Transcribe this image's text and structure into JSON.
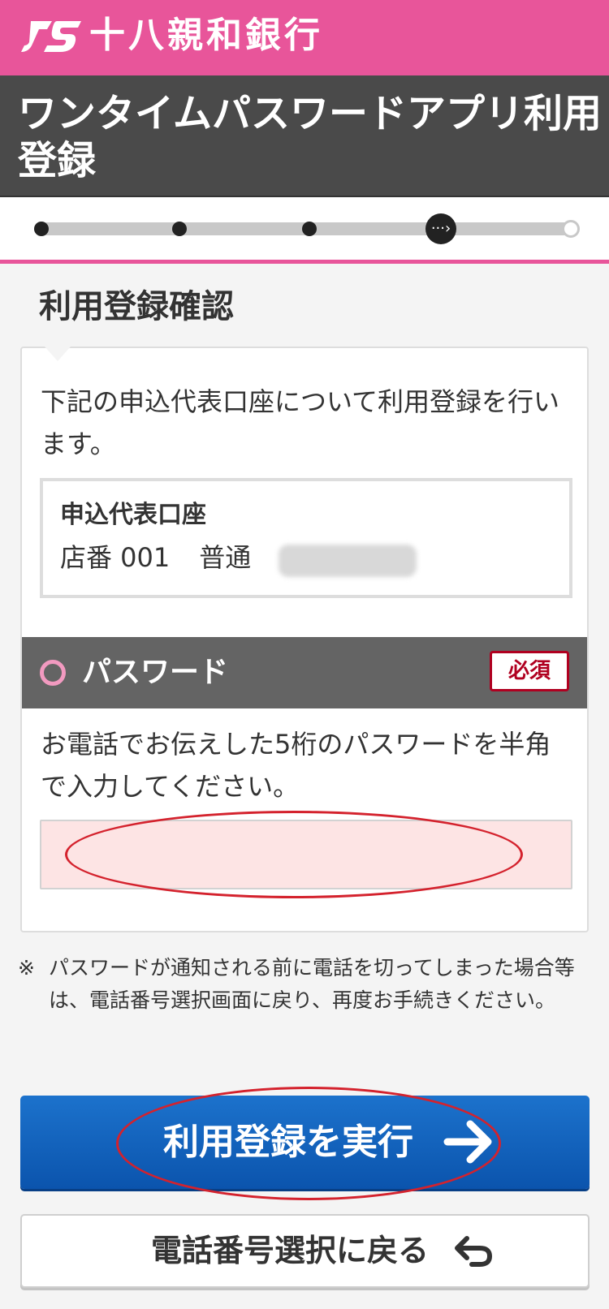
{
  "brand": {
    "name": "十八親和銀行",
    "color": "#e8559a"
  },
  "header": {
    "title": "ワンタイムパスワードアプリ利用登録"
  },
  "progress": {
    "total_steps": 5,
    "current_step": 4
  },
  "section": {
    "title": "利用登録確認"
  },
  "intro": {
    "text": "下記の申込代表口座について利用登録を行います。"
  },
  "account": {
    "label": "申込代表口座",
    "branch": "店番 001",
    "type": "普通"
  },
  "password": {
    "label": "パスワード",
    "required_badge": "必須",
    "description": "お電話でお伝えした5桁のパスワードを半角で入力してください。",
    "value": ""
  },
  "note": {
    "mark": "※",
    "text": "パスワードが通知される前に電話を切ってしまった場合等は、電話番号選択画面に戻り、再度お手続きください。"
  },
  "actions": {
    "submit_label": "利用登録を実行",
    "back_label": "電話番号選択に戻る"
  },
  "colors": {
    "accent": "#e8559a",
    "primary_button": "#1c72cc",
    "highlight": "#d4222d",
    "input_bg": "#fde4e4"
  }
}
